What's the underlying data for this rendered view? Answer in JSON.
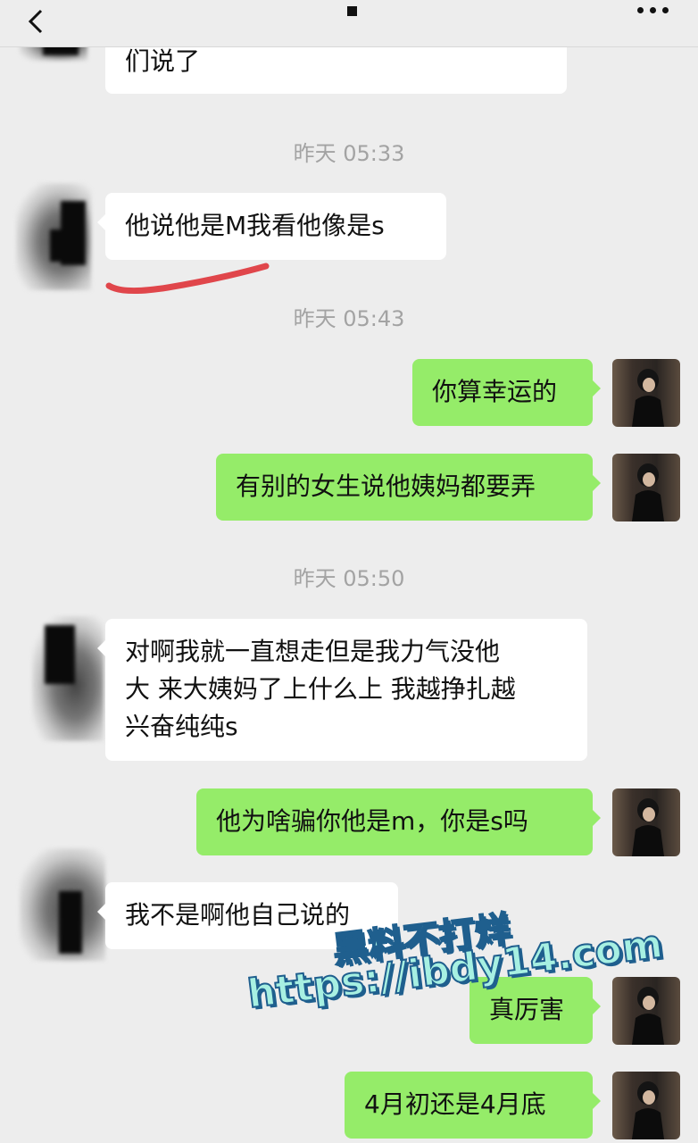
{
  "header": {
    "back_icon": "chevron-left-icon",
    "more_icon": "more-dots-icon"
  },
  "messages": [
    {
      "side": "in",
      "lines": [
        "们说了"
      ]
    },
    {
      "timestamp": "昨天 05:33"
    },
    {
      "side": "in",
      "lines": [
        "他说他是M我看他像是s"
      ]
    },
    {
      "timestamp": "昨天 05:43"
    },
    {
      "side": "out",
      "lines": [
        "你算幸运的"
      ]
    },
    {
      "side": "out",
      "lines": [
        "有别的女生说他姨妈都要弄"
      ]
    },
    {
      "timestamp": "昨天 05:50"
    },
    {
      "side": "in",
      "lines": [
        "对啊我就一直想走但是我力气没他",
        "大  来大姨妈了上什么上 我越挣扎越",
        "兴奋纯纯s"
      ]
    },
    {
      "side": "out",
      "lines": [
        "他为啥骗你他是m，你是s吗"
      ]
    },
    {
      "side": "in",
      "lines": [
        "我不是啊他自己说的"
      ]
    },
    {
      "side": "out",
      "lines": [
        "真厉害"
      ]
    },
    {
      "side": "out",
      "lines": [
        "4月初还是4月底"
      ]
    }
  ],
  "watermark": {
    "line1": "黑料不打烊",
    "line2": "https://ibdy14.com"
  },
  "colors": {
    "background": "#ededed",
    "bubble_in": "#ffffff",
    "bubble_out": "#95ec69",
    "timestamp": "#a3a3a3",
    "underline": "#e0464b"
  }
}
